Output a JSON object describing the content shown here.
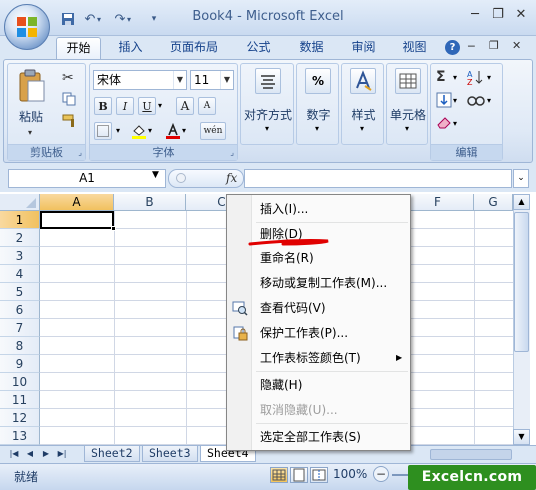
{
  "window": {
    "title": "Book4 - Microsoft Excel"
  },
  "quick_access": {
    "save_icon": "save-icon",
    "undo_icon": "undo-icon",
    "redo_icon": "redo-icon",
    "customize_icon": "customize-qat-icon"
  },
  "ribbon_tabs": [
    {
      "label": "开始",
      "active": true
    },
    {
      "label": "插入"
    },
    {
      "label": "页面布局"
    },
    {
      "label": "公式"
    },
    {
      "label": "数据"
    },
    {
      "label": "审阅"
    },
    {
      "label": "视图"
    }
  ],
  "ribbon": {
    "clipboard": {
      "group_label": "剪贴板",
      "paste_label": "粘贴"
    },
    "font": {
      "group_label": "字体",
      "font_name": "宋体",
      "font_size": "11",
      "bold": "B",
      "italic": "I",
      "underline": "U",
      "grow": "A",
      "shrink": "A",
      "wen": "wén"
    },
    "alignment": {
      "label": "对齐方式"
    },
    "number": {
      "label": "数字",
      "icon_text": "%"
    },
    "styles": {
      "label": "样式"
    },
    "cells": {
      "label": "单元格"
    },
    "editing": {
      "group_label": "编辑",
      "sum_symbol": "Σ"
    }
  },
  "formula_bar": {
    "name_box": "A1",
    "fx_label": "fx",
    "formula": ""
  },
  "columns": [
    "A",
    "B",
    "C",
    "D",
    "E",
    "F",
    "G"
  ],
  "rows": [
    "1",
    "2",
    "3",
    "4",
    "5",
    "6",
    "7",
    "8",
    "9",
    "10",
    "11",
    "12",
    "13"
  ],
  "selected_cell": "A1",
  "sheet_tabs": [
    {
      "label": "Sheet2"
    },
    {
      "label": "Sheet3"
    },
    {
      "label": "Sheet4",
      "active": true
    }
  ],
  "status": {
    "text": "就绪",
    "zoom": "100%"
  },
  "context_menu": {
    "items": [
      {
        "label": "插入(I)..."
      },
      {
        "label": "删除(D)",
        "highlighted_with_red_underline": true
      },
      {
        "label": "重命名(R)"
      },
      {
        "label": "移动或复制工作表(M)..."
      },
      {
        "label": "查看代码(V)",
        "icon": "view-code-icon"
      },
      {
        "label": "保护工作表(P)...",
        "icon": "protect-sheet-icon"
      },
      {
        "label": "工作表标签颜色(T)",
        "submenu": true
      },
      {
        "label": "隐藏(H)"
      },
      {
        "label": "取消隐藏(U)...",
        "disabled": true
      },
      {
        "label": "选定全部工作表(S)"
      }
    ]
  },
  "watermark": {
    "text": "Excelcn.com"
  },
  "colors": {
    "accent": "#15428b",
    "selection_header": "#f1c15f",
    "annotation_red": "#e00000",
    "watermark_green": "#2e8f1f"
  }
}
